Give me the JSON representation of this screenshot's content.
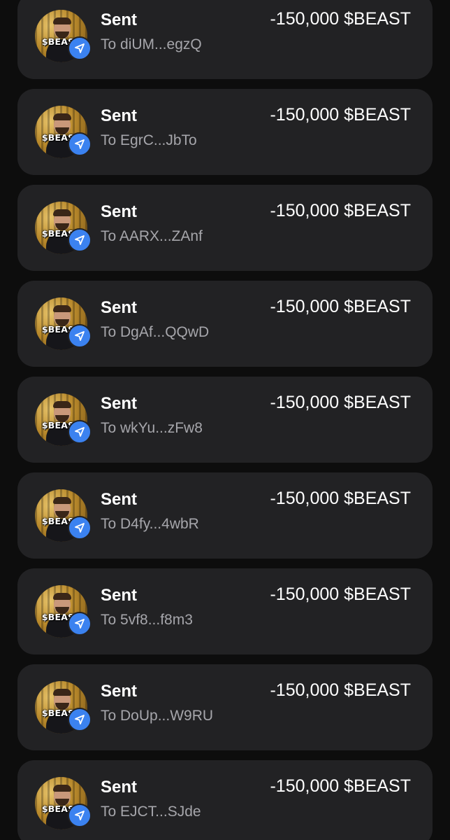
{
  "transactions": [
    {
      "type": "Sent",
      "to": "To diUM...egzQ",
      "amount": "-150,000 $BEAST",
      "avatar_text": "$BEAST",
      "badge_icon": "send-icon"
    },
    {
      "type": "Sent",
      "to": "To EgrC...JbTo",
      "amount": "-150,000 $BEAST",
      "avatar_text": "$BEAST",
      "badge_icon": "send-icon"
    },
    {
      "type": "Sent",
      "to": "To AARX...ZAnf",
      "amount": "-150,000 $BEAST",
      "avatar_text": "$BEAST",
      "badge_icon": "send-icon"
    },
    {
      "type": "Sent",
      "to": "To DgAf...QQwD",
      "amount": "-150,000 $BEAST",
      "avatar_text": "$BEAST",
      "badge_icon": "send-icon"
    },
    {
      "type": "Sent",
      "to": "To wkYu...zFw8",
      "amount": "-150,000 $BEAST",
      "avatar_text": "$BEAST",
      "badge_icon": "send-icon"
    },
    {
      "type": "Sent",
      "to": "To D4fy...4wbR",
      "amount": "-150,000 $BEAST",
      "avatar_text": "$BEAST",
      "badge_icon": "send-icon"
    },
    {
      "type": "Sent",
      "to": "To 5vf8...f8m3",
      "amount": "-150,000 $BEAST",
      "avatar_text": "$BEAST",
      "badge_icon": "send-icon"
    },
    {
      "type": "Sent",
      "to": "To DoUp...W9RU",
      "amount": "-150,000 $BEAST",
      "avatar_text": "$BEAST",
      "badge_icon": "send-icon"
    },
    {
      "type": "Sent",
      "to": "To EJCT...SJde",
      "amount": "-150,000 $BEAST",
      "avatar_text": "$BEAST",
      "badge_icon": "send-icon"
    }
  ],
  "colors": {
    "background": "#0d0d0d",
    "card": "#222224",
    "badge": "#3b82f0",
    "primary_text": "#ffffff",
    "secondary_text": "#a6a6ab"
  }
}
